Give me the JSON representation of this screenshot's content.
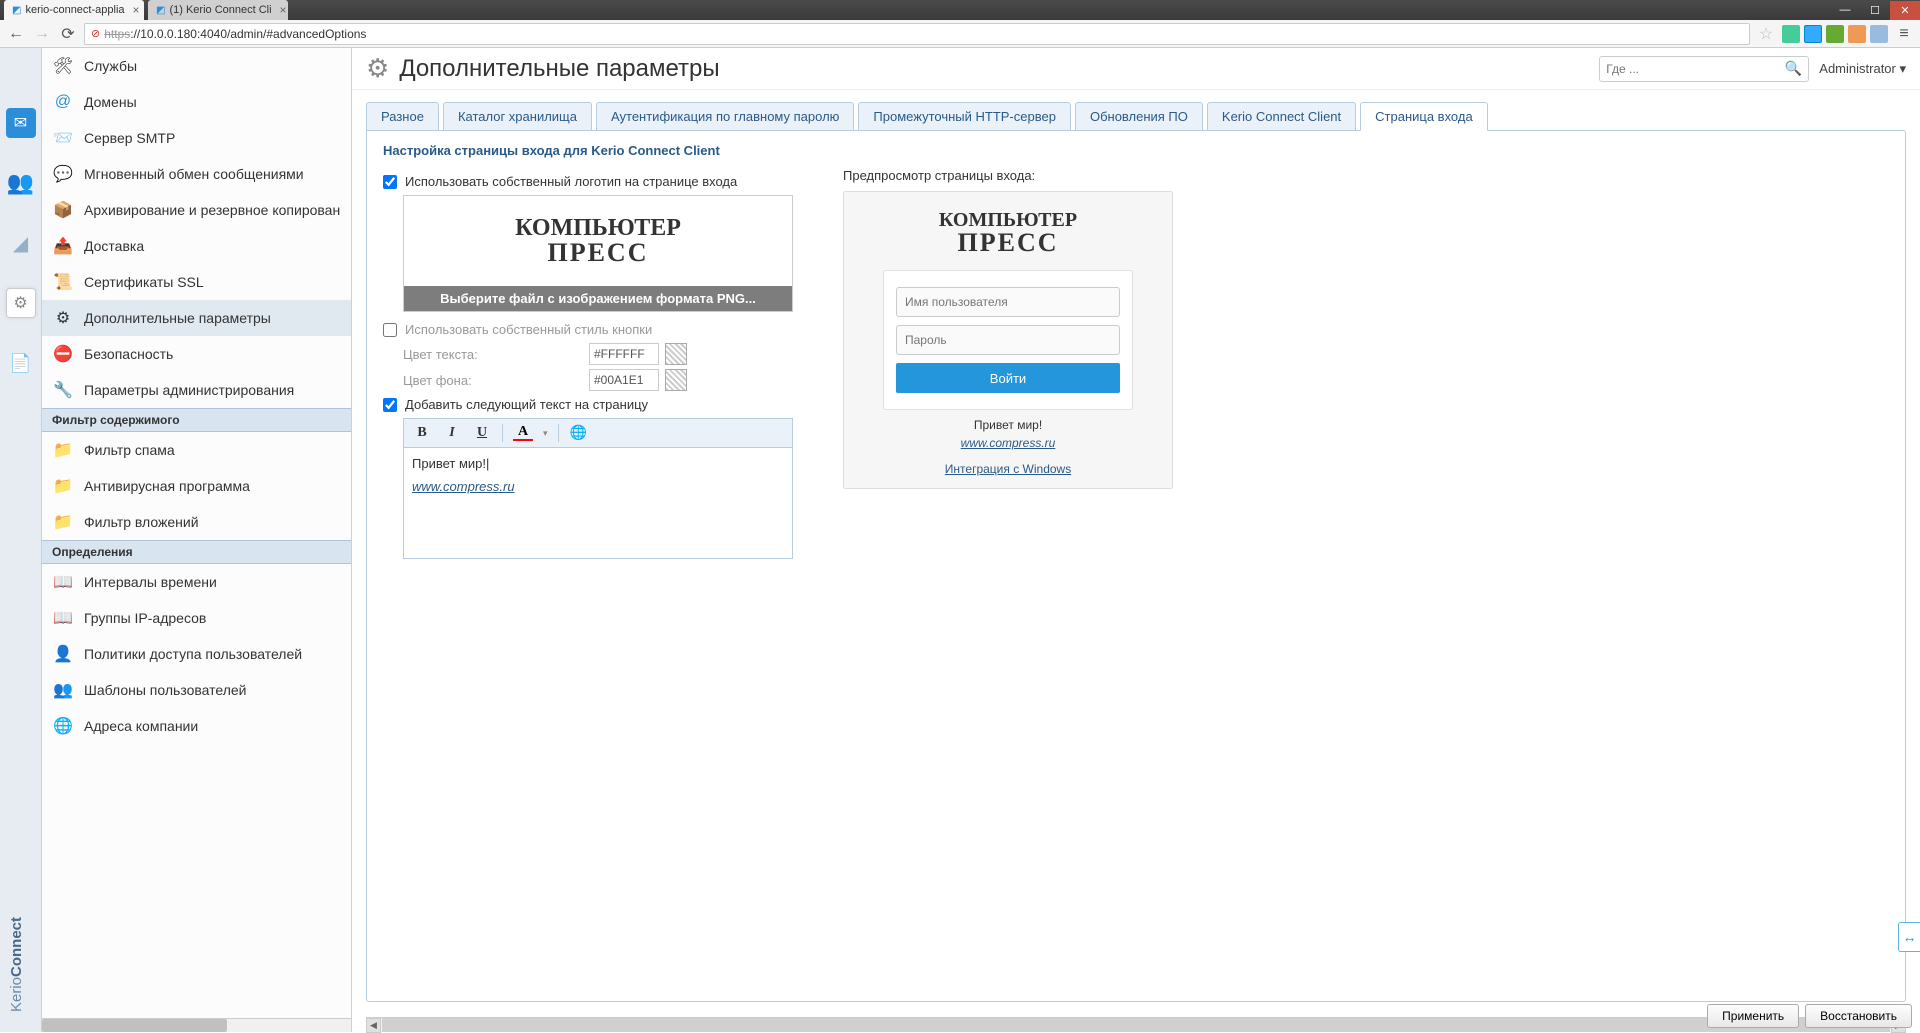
{
  "browser": {
    "tabs": [
      {
        "title": "kerio-connect-applia",
        "icon_color": "#2a8fd8"
      },
      {
        "title": "(1) Kerio Connect Cli",
        "icon_color": "#2a8fd8"
      }
    ],
    "url_prefix": "https",
    "url_host": "://10.0.0.180:",
    "url_port": "4040",
    "url_path": "/admin/#advancedOptions"
  },
  "header": {
    "title": "Дополнительные параметры",
    "search_placeholder": "Где ...",
    "user": "Administrator ▾"
  },
  "sidebar": {
    "items_config": [
      {
        "label": "Службы"
      },
      {
        "label": "Домены"
      },
      {
        "label": "Сервер SMTP"
      },
      {
        "label": "Мгновенный обмен сообщениями"
      },
      {
        "label": "Архивирование и резервное копирован"
      },
      {
        "label": "Доставка"
      },
      {
        "label": "Сертификаты SSL"
      },
      {
        "label": "Дополнительные параметры"
      },
      {
        "label": "Безопасность"
      },
      {
        "label": "Параметры администрирования"
      }
    ],
    "group_filter": "Фильтр содержимого",
    "items_filter": [
      {
        "label": "Фильтр спама"
      },
      {
        "label": "Антивирусная программа"
      },
      {
        "label": "Фильтр вложений"
      }
    ],
    "group_def": "Определения",
    "items_def": [
      {
        "label": "Интервалы времени"
      },
      {
        "label": "Группы IP-адресов"
      },
      {
        "label": "Политики доступа пользователей"
      },
      {
        "label": "Шаблоны пользователей"
      },
      {
        "label": "Адреса компании"
      }
    ]
  },
  "tabs": [
    {
      "label": "Разное"
    },
    {
      "label": "Каталог хранилища"
    },
    {
      "label": "Аутентификация по главному паролю"
    },
    {
      "label": "Промежуточный HTTP-сервер"
    },
    {
      "label": "Обновления ПО"
    },
    {
      "label": "Kerio Connect Client"
    },
    {
      "label": "Страница входа"
    }
  ],
  "form": {
    "fieldset_title": "Настройка страницы входа для Kerio Connect Client",
    "chk_logo": "Использовать собственный логотип на странице входа",
    "logo_line1": "КОМПЬЮТЕР",
    "logo_line2": "ПРЕСС",
    "select_file": "Выберите файл с изображением формата PNG...",
    "chk_style": "Использовать собственный стиль кнопки",
    "text_color_label": "Цвет текста:",
    "text_color_value": "#FFFFFF",
    "bg_color_label": "Цвет фона:",
    "bg_color_value": "#00A1E1",
    "chk_text": "Добавить следующий текст на страницу",
    "editor_greet": "Привет мир!",
    "editor_link": "www.compress.ru"
  },
  "preview": {
    "title": "Предпросмотр страницы входа:",
    "username_ph": "Имя пользователя",
    "password_ph": "Пароль",
    "login_btn": "Войти",
    "greet": "Привет мир!",
    "link": "www.compress.ru",
    "integration": "Интеграция с Windows"
  },
  "footer": {
    "apply": "Применить",
    "restore": "Восстановить"
  },
  "brand": {
    "kerio": "Kerio",
    "connect": "Connect"
  }
}
